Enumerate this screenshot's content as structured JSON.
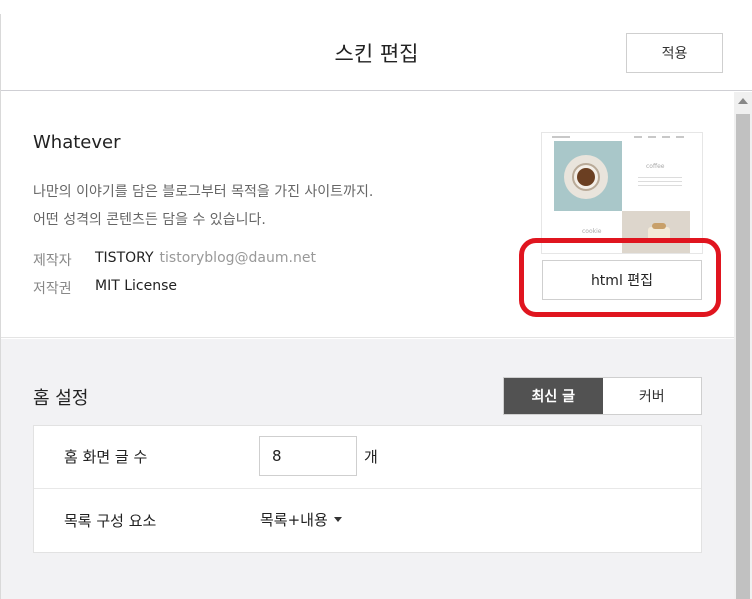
{
  "header": {
    "title": "스킨 편집",
    "apply_label": "적용"
  },
  "skin": {
    "name": "Whatever",
    "description_line1": "나만의 이야기를 담은 블로그부터 목적을 가진 사이트까지.",
    "description_line2": "어떤 성격의 콘텐츠든 담을 수 있습니다.",
    "author_label": "제작자",
    "author": "TISTORY",
    "author_email": "tistoryblog@daum.net",
    "license_label": "저작권",
    "license": "MIT License",
    "thumbnail_text1": "coffee",
    "thumbnail_text2": "cookie",
    "html_edit_label": "html 편집"
  },
  "home_settings": {
    "title": "홈 설정",
    "tabs": [
      {
        "label": "최신 글",
        "active": true
      },
      {
        "label": "커버",
        "active": false
      }
    ],
    "post_count_label": "홈 화면 글 수",
    "post_count_value": "8",
    "post_count_unit": "개",
    "list_components_label": "목록 구성 요소",
    "list_components_value": "목록+내용"
  },
  "colors": {
    "highlight_ring": "#e0151f",
    "active_tab_bg": "#525252"
  }
}
